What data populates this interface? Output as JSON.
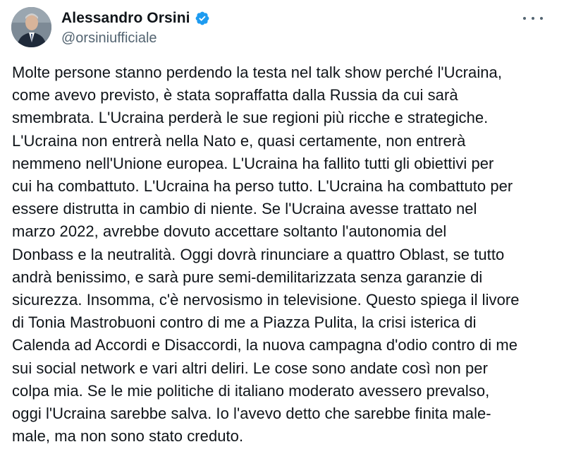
{
  "author": {
    "display_name": "Alessandro Orsini",
    "handle": "@orsiniufficiale",
    "verified": true,
    "verified_color": "#1d9bf0",
    "avatar_icon": "avatar-portrait"
  },
  "actions": {
    "more_icon": "more-horizontal-icon"
  },
  "tweet": {
    "text": "Molte persone stanno perdendo la testa nel talk show perché l'Ucraina,\ncome avevo previsto, è stata sopraffatta dalla Russia da cui sarà\nsmembrata. L'Ucraina perderà le sue regioni più ricche e strategiche.\nL'Ucraina non entrerà nella Nato e, quasi certamente, non entrerà\nnemmeno nell'Unione europea. L'Ucraina ha fallito tutti gli obiettivi per\ncui ha combattuto. L'Ucraina ha perso tutto. L'Ucraina ha combattuto per\nessere distrutta in cambio di niente. Se l'Ucraina avesse trattato nel\nmarzo 2022, avrebbe dovuto accettare soltanto l'autonomia del\nDonbass e la neutralità. Oggi dovrà rinunciare a quattro Oblast, se tutto\nandrà benissimo, e sarà pure semi-demilitarizzata senza garanzie di\nsicurezza. Insomma, c'è nervosismo in televisione. Questo spiega il livore\ndi Tonia Mastrobuoni contro di me a Piazza Pulita, la crisi isterica di\nCalenda ad Accordi e Disaccordi, la nuova campagna d'odio contro di me\nsui social network e vari altri deliri. Le cose sono andate così non per\ncolpa mia. Se le mie politiche di italiano moderato avessero prevalso,\noggi l'Ucraina sarebbe salva. Io l'avevo detto che sarebbe finita male-\nmale, ma non sono stato creduto."
  }
}
